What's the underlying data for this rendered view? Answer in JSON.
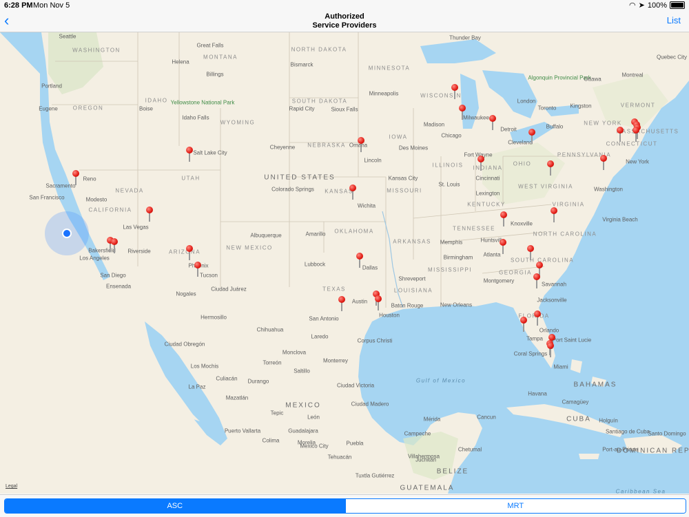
{
  "status_bar": {
    "time": "6:28 PM",
    "date": "Mon Nov 5",
    "battery": "100%"
  },
  "nav": {
    "back_icon": "chevron-left-icon",
    "title_line1": "Authorized",
    "title_line2": "Service Providers",
    "list_label": "List"
  },
  "map": {
    "legal": "Legal",
    "labels": [
      {
        "text": "UNITED STATES",
        "kind": "country"
      },
      {
        "text": "MEXICO",
        "kind": "country"
      },
      {
        "text": "CUBA",
        "kind": "country"
      },
      {
        "text": "BAHAMAS",
        "kind": "country"
      },
      {
        "text": "BELIZE",
        "kind": "country"
      },
      {
        "text": "GUATEMALA",
        "kind": "country"
      },
      {
        "text": "DOMINICAN REPUBLIC",
        "kind": "country"
      },
      {
        "text": "WASHINGTON",
        "kind": "state"
      },
      {
        "text": "OREGON",
        "kind": "state"
      },
      {
        "text": "IDAHO",
        "kind": "state"
      },
      {
        "text": "MONTANA",
        "kind": "state"
      },
      {
        "text": "WYOMING",
        "kind": "state"
      },
      {
        "text": "NORTH DAKOTA",
        "kind": "state"
      },
      {
        "text": "SOUTH DAKOTA",
        "kind": "state"
      },
      {
        "text": "NEBRASKA",
        "kind": "state"
      },
      {
        "text": "KANSAS",
        "kind": "state"
      },
      {
        "text": "OKLAHOMA",
        "kind": "state"
      },
      {
        "text": "TEXAS",
        "kind": "state"
      },
      {
        "text": "NEVADA",
        "kind": "state"
      },
      {
        "text": "UTAH",
        "kind": "state"
      },
      {
        "text": "CALIFORNIA",
        "kind": "state"
      },
      {
        "text": "ARIZONA",
        "kind": "state"
      },
      {
        "text": "NEW MEXICO",
        "kind": "state"
      },
      {
        "text": "MINNESOTA",
        "kind": "state"
      },
      {
        "text": "IOWA",
        "kind": "state"
      },
      {
        "text": "MISSOURI",
        "kind": "state"
      },
      {
        "text": "ARKANSAS",
        "kind": "state"
      },
      {
        "text": "MISSISSIPPI",
        "kind": "state"
      },
      {
        "text": "LOUISIANA",
        "kind": "state"
      },
      {
        "text": "WISCONSIN",
        "kind": "state"
      },
      {
        "text": "ILLINOIS",
        "kind": "state"
      },
      {
        "text": "INDIANA",
        "kind": "state"
      },
      {
        "text": "OHIO",
        "kind": "state"
      },
      {
        "text": "KENTUCKY",
        "kind": "state"
      },
      {
        "text": "TENNESSEE",
        "kind": "state"
      },
      {
        "text": "GEORGIA",
        "kind": "state"
      },
      {
        "text": "FLORIDA",
        "kind": "state"
      },
      {
        "text": "VIRGINIA",
        "kind": "state"
      },
      {
        "text": "PENNSYLVANIA",
        "kind": "state"
      },
      {
        "text": "NEW YORK",
        "kind": "state"
      },
      {
        "text": "VERMONT",
        "kind": "state"
      },
      {
        "text": "MASSACHUSETTS",
        "kind": "state"
      },
      {
        "text": "CONNECTICUT",
        "kind": "state"
      },
      {
        "text": "NORTH CAROLINA",
        "kind": "state"
      },
      {
        "text": "SOUTH CAROLINA",
        "kind": "state"
      },
      {
        "text": "WEST VIRGINIA",
        "kind": "state"
      },
      {
        "text": "Gulf of Mexico",
        "kind": "water"
      },
      {
        "text": "Caribbean Sea",
        "kind": "water"
      },
      {
        "text": "Yellowstone National Park",
        "kind": "park"
      },
      {
        "text": "Algonquin Provincial Park",
        "kind": "park"
      },
      {
        "text": "Seattle",
        "kind": "city"
      },
      {
        "text": "Portland",
        "kind": "city"
      },
      {
        "text": "Eugene",
        "kind": "city"
      },
      {
        "text": "Boise",
        "kind": "city"
      },
      {
        "text": "Great Falls",
        "kind": "city"
      },
      {
        "text": "Helena",
        "kind": "city"
      },
      {
        "text": "Billings",
        "kind": "city"
      },
      {
        "text": "Idaho Falls",
        "kind": "city"
      },
      {
        "text": "Bismarck",
        "kind": "city"
      },
      {
        "text": "Rapid City",
        "kind": "city"
      },
      {
        "text": "Sioux Falls",
        "kind": "city"
      },
      {
        "text": "Minneapolis",
        "kind": "city"
      },
      {
        "text": "Salt Lake City",
        "kind": "city"
      },
      {
        "text": "Cheyenne",
        "kind": "city"
      },
      {
        "text": "Reno",
        "kind": "city"
      },
      {
        "text": "Sacramento",
        "kind": "city"
      },
      {
        "text": "San Francisco",
        "kind": "city"
      },
      {
        "text": "Modesto",
        "kind": "city"
      },
      {
        "text": "Las Vegas",
        "kind": "city"
      },
      {
        "text": "Bakersfield",
        "kind": "city"
      },
      {
        "text": "Los Angeles",
        "kind": "city"
      },
      {
        "text": "Riverside",
        "kind": "city"
      },
      {
        "text": "San Diego",
        "kind": "city"
      },
      {
        "text": "Ensenada",
        "kind": "city"
      },
      {
        "text": "Phoenix",
        "kind": "city"
      },
      {
        "text": "Tucson",
        "kind": "city"
      },
      {
        "text": "Nogales",
        "kind": "city"
      },
      {
        "text": "Albuquerque",
        "kind": "city"
      },
      {
        "text": "Colorado Springs",
        "kind": "city"
      },
      {
        "text": "Omaha",
        "kind": "city"
      },
      {
        "text": "Lincoln",
        "kind": "city"
      },
      {
        "text": "Des Moines",
        "kind": "city"
      },
      {
        "text": "Kansas City",
        "kind": "city"
      },
      {
        "text": "Wichita",
        "kind": "city"
      },
      {
        "text": "Amarillo",
        "kind": "city"
      },
      {
        "text": "Lubbock",
        "kind": "city"
      },
      {
        "text": "Dallas",
        "kind": "city"
      },
      {
        "text": "Austin",
        "kind": "city"
      },
      {
        "text": "San Antonio",
        "kind": "city"
      },
      {
        "text": "Houston",
        "kind": "city"
      },
      {
        "text": "Ciudad Juárez",
        "kind": "city"
      },
      {
        "text": "Hermosillo",
        "kind": "city"
      },
      {
        "text": "Chihuahua",
        "kind": "city"
      },
      {
        "text": "Laredo",
        "kind": "city"
      },
      {
        "text": "Corpus Christi",
        "kind": "city"
      },
      {
        "text": "Monclova",
        "kind": "city"
      },
      {
        "text": "Monterrey",
        "kind": "city"
      },
      {
        "text": "Torreón",
        "kind": "city"
      },
      {
        "text": "Saltillo",
        "kind": "city"
      },
      {
        "text": "Ciudad Obregón",
        "kind": "city"
      },
      {
        "text": "Los Mochis",
        "kind": "city"
      },
      {
        "text": "Culiacán",
        "kind": "city"
      },
      {
        "text": "Durango",
        "kind": "city"
      },
      {
        "text": "La Paz",
        "kind": "city"
      },
      {
        "text": "Mazatlán",
        "kind": "city"
      },
      {
        "text": "Ciudad Victoria",
        "kind": "city"
      },
      {
        "text": "Ciudad Madero",
        "kind": "city"
      },
      {
        "text": "Tepic",
        "kind": "city"
      },
      {
        "text": "León",
        "kind": "city"
      },
      {
        "text": "Guadalajara",
        "kind": "city"
      },
      {
        "text": "Puerto Vallarta",
        "kind": "city"
      },
      {
        "text": "Colima",
        "kind": "city"
      },
      {
        "text": "Morelia",
        "kind": "city"
      },
      {
        "text": "Mexico City",
        "kind": "city"
      },
      {
        "text": "Puebla",
        "kind": "city"
      },
      {
        "text": "Tehuacán",
        "kind": "city"
      },
      {
        "text": "Juchitán",
        "kind": "city"
      },
      {
        "text": "Tuxtla Gutiérrez",
        "kind": "city"
      },
      {
        "text": "Villahermosa",
        "kind": "city"
      },
      {
        "text": "Campeche",
        "kind": "city"
      },
      {
        "text": "Mérida",
        "kind": "city"
      },
      {
        "text": "Cancun",
        "kind": "city"
      },
      {
        "text": "Chetumal",
        "kind": "city"
      },
      {
        "text": "Chicago",
        "kind": "city"
      },
      {
        "text": "Milwaukee",
        "kind": "city"
      },
      {
        "text": "Madison",
        "kind": "city"
      },
      {
        "text": "Detroit",
        "kind": "city"
      },
      {
        "text": "Toronto",
        "kind": "city"
      },
      {
        "text": "London",
        "kind": "city"
      },
      {
        "text": "Buffalo",
        "kind": "city"
      },
      {
        "text": "Cleveland",
        "kind": "city"
      },
      {
        "text": "Fort Wayne",
        "kind": "city"
      },
      {
        "text": "Cincinnati",
        "kind": "city"
      },
      {
        "text": "St. Louis",
        "kind": "city"
      },
      {
        "text": "Lexington",
        "kind": "city"
      },
      {
        "text": "Knoxville",
        "kind": "city"
      },
      {
        "text": "Memphis",
        "kind": "city"
      },
      {
        "text": "Huntsville",
        "kind": "city"
      },
      {
        "text": "Birmingham",
        "kind": "city"
      },
      {
        "text": "Atlanta",
        "kind": "city"
      },
      {
        "text": "Shreveport",
        "kind": "city"
      },
      {
        "text": "Baton Rouge",
        "kind": "city"
      },
      {
        "text": "New Orleans",
        "kind": "city"
      },
      {
        "text": "Montgomery",
        "kind": "city"
      },
      {
        "text": "Savannah",
        "kind": "city"
      },
      {
        "text": "Jacksonville",
        "kind": "city"
      },
      {
        "text": "Orlando",
        "kind": "city"
      },
      {
        "text": "Tampa",
        "kind": "city"
      },
      {
        "text": "Port Saint Lucie",
        "kind": "city"
      },
      {
        "text": "Coral Springs",
        "kind": "city"
      },
      {
        "text": "Miami",
        "kind": "city"
      },
      {
        "text": "Washington",
        "kind": "city"
      },
      {
        "text": "Virginia Beach",
        "kind": "city"
      },
      {
        "text": "New York",
        "kind": "city"
      },
      {
        "text": "Kingston",
        "kind": "city"
      },
      {
        "text": "Ottawa",
        "kind": "city"
      },
      {
        "text": "Montreal",
        "kind": "city"
      },
      {
        "text": "Quebec City",
        "kind": "city"
      },
      {
        "text": "Havana",
        "kind": "city"
      },
      {
        "text": "Camagüey",
        "kind": "city"
      },
      {
        "text": "Holguín",
        "kind": "city"
      },
      {
        "text": "Santiago de Cuba",
        "kind": "city"
      },
      {
        "text": "Port-au-Prince",
        "kind": "city"
      },
      {
        "text": "Santo Domingo",
        "kind": "city"
      },
      {
        "text": "Thunder Bay",
        "kind": "city"
      }
    ],
    "pin_count": 46
  },
  "segmented": {
    "options": [
      "ASC",
      "MRT"
    ],
    "selected": "ASC",
    "accent": "#0a7aff"
  }
}
